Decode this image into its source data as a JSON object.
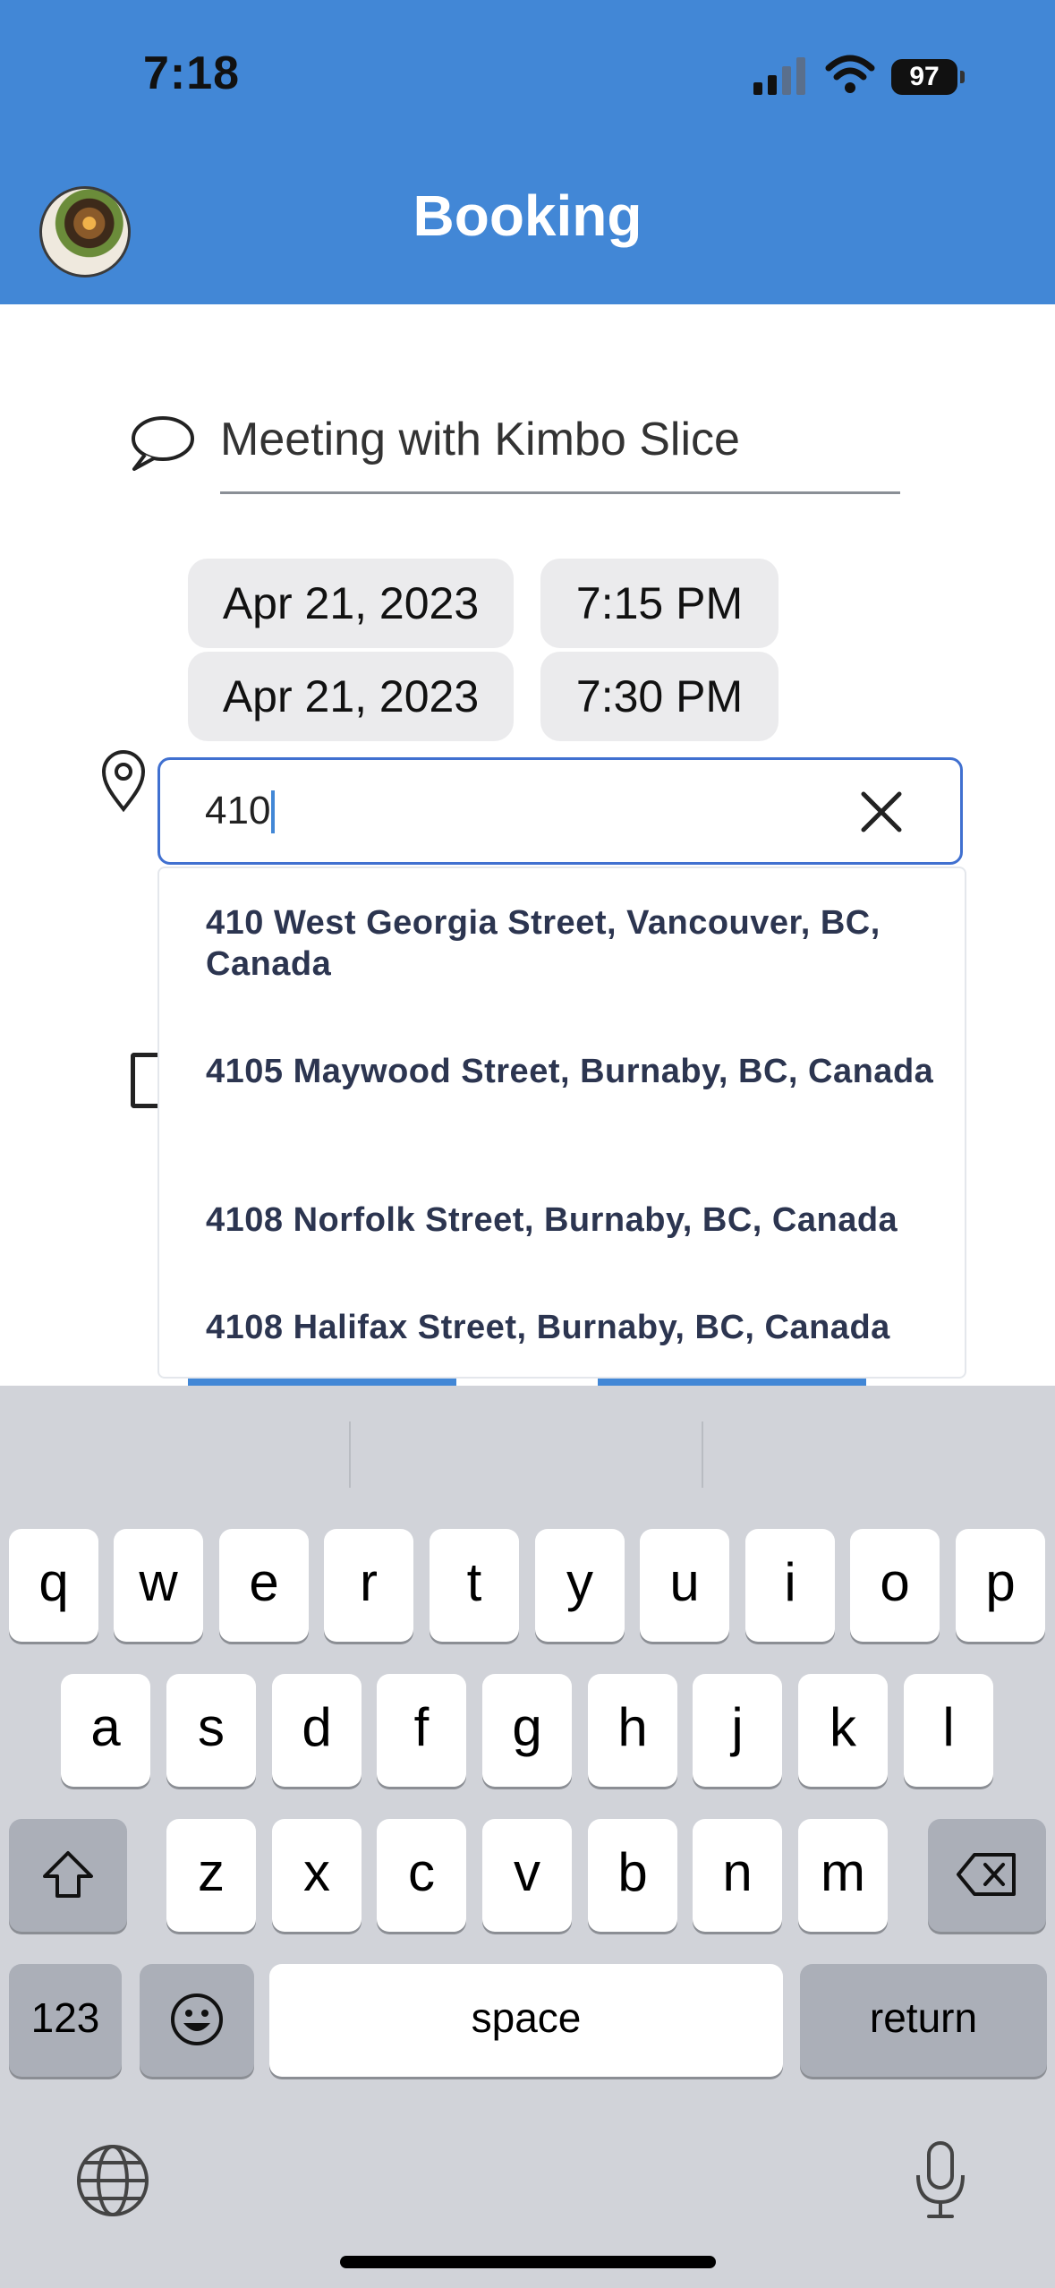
{
  "status_bar": {
    "time": "7:18",
    "battery": "97"
  },
  "header": {
    "title": "Booking"
  },
  "form": {
    "meeting_title": "Meeting with Kimbo Slice",
    "start_date": "Apr 21, 2023",
    "start_time": "7:15 PM",
    "end_date": "Apr 21, 2023",
    "end_time": "7:30 PM",
    "location_value": "410"
  },
  "suggestions": [
    "410 West Georgia Street, Vancouver, BC, Canada",
    "4105 Maywood Street, Burnaby, BC, Canada",
    "4108 Norfolk Street, Burnaby, BC, Canada",
    "4108 Halifax Street, Burnaby, BC, Canada"
  ],
  "keyboard": {
    "row1": [
      "q",
      "w",
      "e",
      "r",
      "t",
      "y",
      "u",
      "i",
      "o",
      "p"
    ],
    "row2": [
      "a",
      "s",
      "d",
      "f",
      "g",
      "h",
      "j",
      "k",
      "l"
    ],
    "row3": [
      "z",
      "x",
      "c",
      "v",
      "b",
      "n",
      "m"
    ],
    "numbers_label": "123",
    "space_label": "space",
    "return_label": "return"
  },
  "colors": {
    "header": "#4287d6",
    "accent": "#4070d0",
    "keyboard_bg": "#d1d3d9"
  }
}
